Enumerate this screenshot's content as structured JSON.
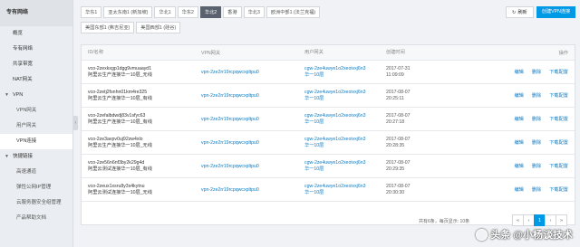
{
  "sidebar": {
    "header": "专有网络",
    "items": [
      "概览",
      "专有网络",
      "共享带宽",
      "NAT网关"
    ],
    "groups": [
      {
        "label": "VPN",
        "subs": [
          "VPN网关",
          "用户网关",
          "VPN连接"
        ]
      },
      {
        "label": "快捷链接",
        "subs": [
          "高速通道",
          "弹性公网IP管理",
          "云服务器安全组管理",
          "产品帮助文档"
        ]
      }
    ]
  },
  "regions": {
    "row1": [
      "华东1",
      "亚太东南1 (新加坡)",
      "华北1",
      "华东2",
      "华北2",
      "香港",
      "华北3",
      "欧洲中部1 (法兰克福)"
    ],
    "row2": [
      "美国东部1 (弗吉尼亚)",
      "美国西部1 (硅谷)"
    ],
    "active": "华北2"
  },
  "toolbar": {
    "refresh": "刷新",
    "create": "创建VPN连接"
  },
  "table": {
    "headers": [
      "ID/名称",
      "VPN网关",
      "用户网关",
      "创建时间",
      "操作"
    ],
    "rows": [
      {
        "id": "vco-2zexkxgp1dgg9vmuaayd1",
        "name": "阿里云生产连接华一10层_无线",
        "vpn": "vpn-2ze2rr19rcpqwcxpltpu0",
        "cgw1": "cgw-2ze4uwye1o2xeoivxj6n3",
        "cgw2": "华一10层",
        "date": "2017-07-31",
        "time": "11:09:09"
      },
      {
        "id": "vco-2zetj2fsnhn01km4re325",
        "name": "阿里云生产连接华一10层_有线",
        "vpn": "vpn-2ze2rr19rcpqwcxpltpu0",
        "cgw1": "cgw-2ze4uwye1o2xeoivxj6n3",
        "cgw2": "华一10层",
        "date": "2017-08-07",
        "time": "20:25:11"
      },
      {
        "id": "vco-2zefalbdwdj83v1sfyc63",
        "name": "阿里云生产连接华一10层_有线",
        "vpn": "vpn-2ze2rr19rcpqwcxpltpu0",
        "cgw1": "cgw-2ze4uwye1o2xeoivxj6n3",
        "cgw2": "华一10层",
        "date": "2017-08-07",
        "time": "20:27:18"
      },
      {
        "id": "vco-2ze3avpv0uj92zw4xlo",
        "name": "阿里云生产连接华一10层_无线",
        "vpn": "vpn-2ze2rr19rcpqwcxpltpu0",
        "cgw1": "cgw-2ze4uwye1o2xeoivxj6n3",
        "cgw2": "华一10层",
        "date": "2017-08-07",
        "time": "20:28:35"
      },
      {
        "id": "vco-2ze56n6nf3by2k29g4d",
        "name": "阿里云测试连接华一10层_有线",
        "vpn": "vpn-2ze2rr19rcpqwcxpltpu0",
        "cgw1": "cgw-2ze4uwye1o2xeoivxj6n3",
        "cgw2": "华一10层",
        "date": "2017-08-07",
        "time": "20:29:35"
      },
      {
        "id": "vco-2zeux1xsru8y3s4kytnu",
        "name": "阿里云测试连接华一10层_无线",
        "vpn": "vpn-2ze2rr19rcpqwcxpltpu0",
        "cgw1": "cgw-2ze4uwye1o2xeoivxj6n3",
        "cgw2": "华一10层",
        "date": "2017-08-07",
        "time": "20:30:30"
      }
    ],
    "actions": [
      "编辑",
      "删除",
      "下载配置"
    ]
  },
  "pager": {
    "info": "共有6条，每页显示: 10条",
    "prev2": "«",
    "prev": "‹",
    "page": "1",
    "next": "›",
    "next2": "»"
  },
  "watermark": "头条 @小杨谈技术"
}
